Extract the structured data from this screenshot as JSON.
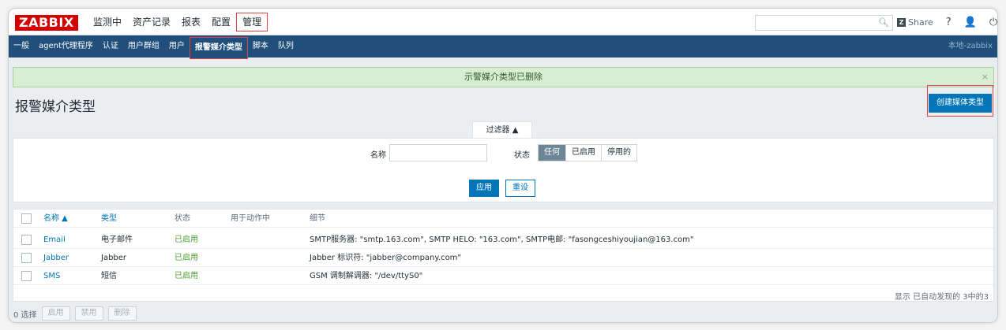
{
  "app": {
    "logo": "ZABBIX"
  },
  "topmenu": [
    "监测中",
    "资产记录",
    "报表",
    "配置",
    "管理"
  ],
  "top_right": {
    "search_placeholder": "",
    "share": "Share",
    "help": "?",
    "user": "👤",
    "logout": "⏻"
  },
  "subnav": [
    "一般",
    "agent代理程序",
    "认证",
    "用户群组",
    "用户",
    "报警媒介类型",
    "脚本",
    "队列"
  ],
  "subnav_right": "本地-zabbix",
  "message": "示警媒介类型已删除",
  "page_title": "报警媒介类型",
  "create_button": "创建媒体类型",
  "filter": {
    "tab_label": "过滤器 ▲",
    "name_label": "名称",
    "name_value": "",
    "status_label": "状态",
    "status_options": [
      "任何",
      "已启用",
      "停用的"
    ],
    "selected_status": "任何",
    "apply": "应用",
    "reset": "重设"
  },
  "table": {
    "headers": {
      "name": "名称 ▲",
      "type": "类型",
      "status": "状态",
      "used_in_actions": "用于动作中",
      "details": "细节"
    },
    "rows": [
      {
        "name": "Email",
        "type": "电子邮件",
        "status": "已启用",
        "details": "SMTP服务器: \"smtp.163.com\", SMTP HELO: \"163.com\", SMTP电邮: \"fasongceshiyoujian@163.com\""
      },
      {
        "name": "Jabber",
        "type": "Jabber",
        "status": "已启用",
        "details": "Jabber 标识符: \"jabber@company.com\""
      },
      {
        "name": "SMS",
        "type": "短信",
        "status": "已启用",
        "details": "GSM 调制解调器: \"/dev/ttyS0\""
      }
    ],
    "footer": "显示 已自动发现的 3中的3"
  },
  "bottom": {
    "selected": "0 选择",
    "buttons": [
      "启用",
      "禁用",
      "删除"
    ]
  },
  "colors": {
    "brand": "#d40000",
    "nav": "#1f4f7a",
    "primary": "#0275b8",
    "enabled": "#4c9e2f",
    "highlight": "#e04040"
  }
}
